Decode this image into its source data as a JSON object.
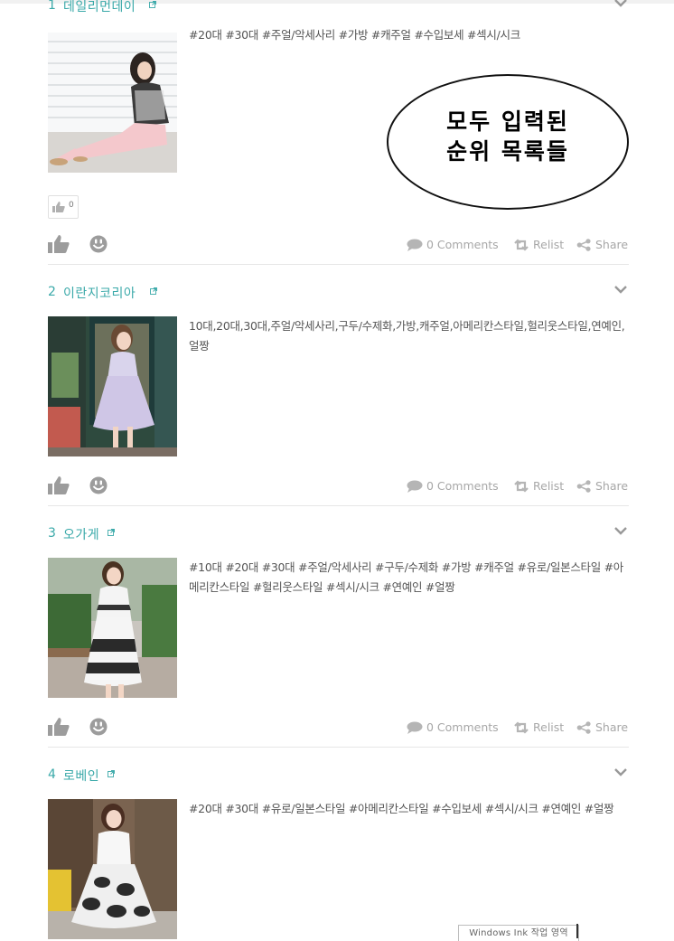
{
  "listings": [
    {
      "rank": "1",
      "name": "데일리먼데이",
      "tags": "#20대 #30대 #주얼/악세사리 #가방 #캐주얼 #수입보세 #섹시/시크",
      "like_count": "0",
      "comments": "0 Comments",
      "relist": "Relist",
      "share": "Share"
    },
    {
      "rank": "2",
      "name": "이란지코리아",
      "tags": "10대,20대,30대,주얼/악세사리,구두/수제화,가방,캐주얼,아메리칸스타일,헐리웃스타일,연예인,얼짱",
      "comments": "0 Comments",
      "relist": "Relist",
      "share": "Share"
    },
    {
      "rank": "3",
      "name": "오가게",
      "tags": "#10대 #20대 #30대 #주얼/악세사리 #구두/수제화 #가방 #캐주얼 #유로/일본스타일 #아메리칸스타일 #헐리웃스타일 #섹시/시크 #연예인 #얼짱",
      "comments": "0 Comments",
      "relist": "Relist",
      "share": "Share"
    },
    {
      "rank": "4",
      "name": "로베인",
      "tags": "#20대 #30대 #유로/일본스타일 #아메리칸스타일 #수입보세 #섹시/시크 #연예인 #얼짱"
    }
  ],
  "callout": {
    "line1": "모두 입력된",
    "line2": "순위 목록들"
  },
  "ink_workspace": "Windows Ink 작업 영역",
  "colors": {
    "accent": "#3aa9a9",
    "muted": "#a7a7a7",
    "divider": "#e6e6e6"
  },
  "icons": {
    "external": "external-link-icon",
    "chevron": "chevron-down-icon",
    "like": "thumbs-up-icon",
    "smile": "smiley-icon",
    "comment": "speech-bubble-icon",
    "relist": "retweet-icon",
    "share": "share-icon"
  }
}
